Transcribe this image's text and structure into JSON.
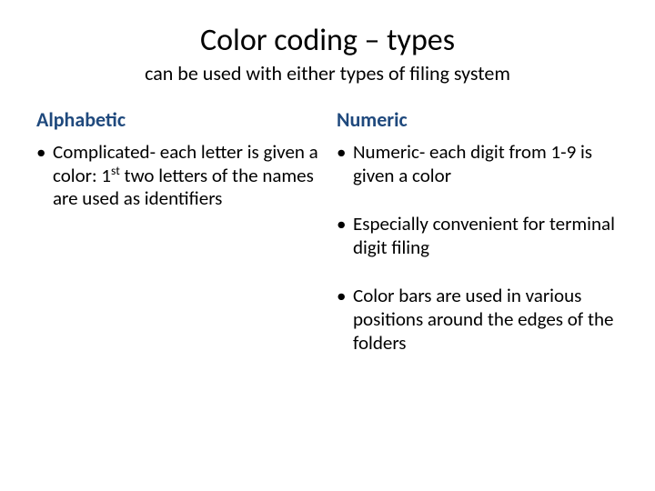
{
  "title": "Color coding – types",
  "subtitle": "can be used with either types of filing system",
  "left": {
    "heading": "Alphabetic",
    "items": [
      {
        "pre": "Complicated- each letter is given a color: 1",
        "sup": "st",
        "post": " two letters of the names are used as identifiers"
      }
    ]
  },
  "right": {
    "heading": "Numeric",
    "items": [
      "Numeric- each digit from 1-9 is given a color",
      "Especially convenient for terminal digit filing",
      "Color bars are used in various positions around the edges of the folders"
    ]
  }
}
